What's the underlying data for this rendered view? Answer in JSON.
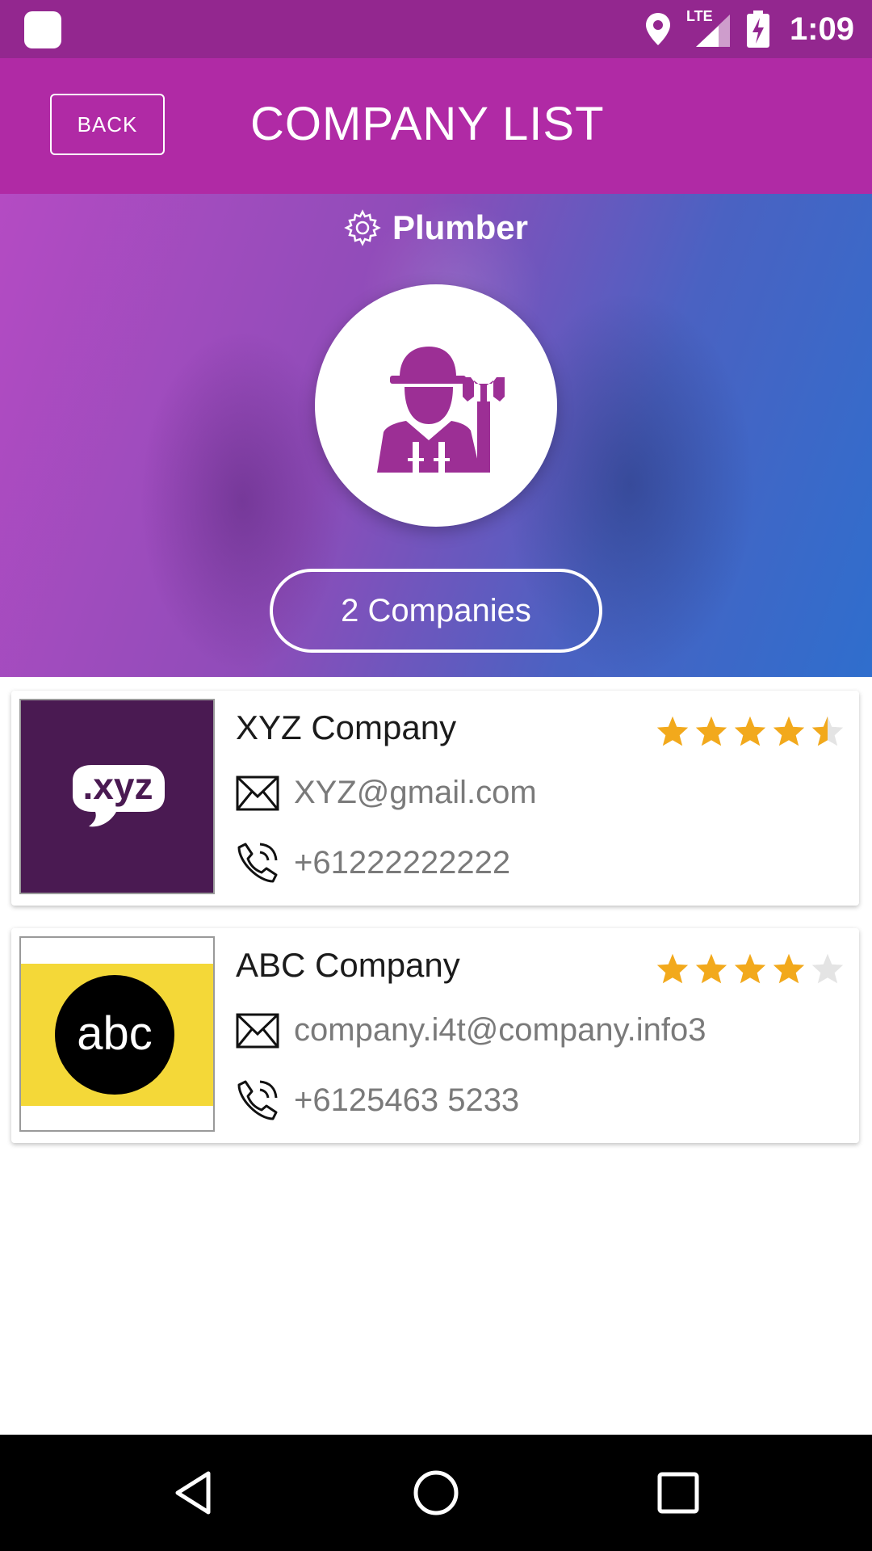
{
  "status_bar": {
    "time": "1:09",
    "network": "LTE",
    "icons": [
      "app-icon",
      "location-icon",
      "signal-icon",
      "battery-charging-icon"
    ]
  },
  "header": {
    "back_label": "BACK",
    "title": "COMPANY LIST"
  },
  "hero": {
    "category_icon": "gear-icon",
    "category": "Plumber",
    "category_avatar_icon": "plumber-icon",
    "companies_count_label": "2 Companies"
  },
  "companies": [
    {
      "name": "XYZ Company",
      "email": "XYZ@gmail.com",
      "phone": "+61222222222",
      "rating": 4.5,
      "rating_max": 5,
      "logo_text": ".xyz",
      "logo_bg": "#4a1a52"
    },
    {
      "name": "ABC Company",
      "email": "company.i4t@company.info3",
      "phone": "+6125463 5233",
      "rating": 4,
      "rating_max": 5,
      "logo_text": "abc",
      "logo_bg": "#f4d838"
    }
  ],
  "nav_bar": {
    "icons": [
      "back-triangle-icon",
      "home-circle-icon",
      "recents-square-icon"
    ]
  },
  "colors": {
    "status_bar": "#93278f",
    "app_bar": "#b02aa5",
    "accent_purple": "#9c2f95",
    "star_filled": "#f2a91c",
    "star_empty": "#e4e4e4"
  }
}
